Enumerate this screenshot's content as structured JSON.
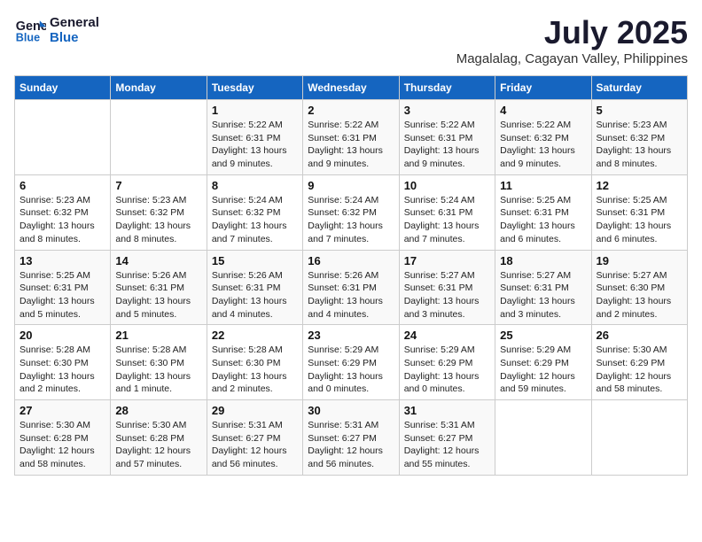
{
  "logo": {
    "line1": "General",
    "line2": "Blue"
  },
  "title": "July 2025",
  "location": "Magalalag, Cagayan Valley, Philippines",
  "weekdays": [
    "Sunday",
    "Monday",
    "Tuesday",
    "Wednesday",
    "Thursday",
    "Friday",
    "Saturday"
  ],
  "weeks": [
    [
      {
        "day": "",
        "info": ""
      },
      {
        "day": "",
        "info": ""
      },
      {
        "day": "1",
        "info": "Sunrise: 5:22 AM\nSunset: 6:31 PM\nDaylight: 13 hours and 9 minutes."
      },
      {
        "day": "2",
        "info": "Sunrise: 5:22 AM\nSunset: 6:31 PM\nDaylight: 13 hours and 9 minutes."
      },
      {
        "day": "3",
        "info": "Sunrise: 5:22 AM\nSunset: 6:31 PM\nDaylight: 13 hours and 9 minutes."
      },
      {
        "day": "4",
        "info": "Sunrise: 5:22 AM\nSunset: 6:32 PM\nDaylight: 13 hours and 9 minutes."
      },
      {
        "day": "5",
        "info": "Sunrise: 5:23 AM\nSunset: 6:32 PM\nDaylight: 13 hours and 8 minutes."
      }
    ],
    [
      {
        "day": "6",
        "info": "Sunrise: 5:23 AM\nSunset: 6:32 PM\nDaylight: 13 hours and 8 minutes."
      },
      {
        "day": "7",
        "info": "Sunrise: 5:23 AM\nSunset: 6:32 PM\nDaylight: 13 hours and 8 minutes."
      },
      {
        "day": "8",
        "info": "Sunrise: 5:24 AM\nSunset: 6:32 PM\nDaylight: 13 hours and 7 minutes."
      },
      {
        "day": "9",
        "info": "Sunrise: 5:24 AM\nSunset: 6:32 PM\nDaylight: 13 hours and 7 minutes."
      },
      {
        "day": "10",
        "info": "Sunrise: 5:24 AM\nSunset: 6:31 PM\nDaylight: 13 hours and 7 minutes."
      },
      {
        "day": "11",
        "info": "Sunrise: 5:25 AM\nSunset: 6:31 PM\nDaylight: 13 hours and 6 minutes."
      },
      {
        "day": "12",
        "info": "Sunrise: 5:25 AM\nSunset: 6:31 PM\nDaylight: 13 hours and 6 minutes."
      }
    ],
    [
      {
        "day": "13",
        "info": "Sunrise: 5:25 AM\nSunset: 6:31 PM\nDaylight: 13 hours and 5 minutes."
      },
      {
        "day": "14",
        "info": "Sunrise: 5:26 AM\nSunset: 6:31 PM\nDaylight: 13 hours and 5 minutes."
      },
      {
        "day": "15",
        "info": "Sunrise: 5:26 AM\nSunset: 6:31 PM\nDaylight: 13 hours and 4 minutes."
      },
      {
        "day": "16",
        "info": "Sunrise: 5:26 AM\nSunset: 6:31 PM\nDaylight: 13 hours and 4 minutes."
      },
      {
        "day": "17",
        "info": "Sunrise: 5:27 AM\nSunset: 6:31 PM\nDaylight: 13 hours and 3 minutes."
      },
      {
        "day": "18",
        "info": "Sunrise: 5:27 AM\nSunset: 6:31 PM\nDaylight: 13 hours and 3 minutes."
      },
      {
        "day": "19",
        "info": "Sunrise: 5:27 AM\nSunset: 6:30 PM\nDaylight: 13 hours and 2 minutes."
      }
    ],
    [
      {
        "day": "20",
        "info": "Sunrise: 5:28 AM\nSunset: 6:30 PM\nDaylight: 13 hours and 2 minutes."
      },
      {
        "day": "21",
        "info": "Sunrise: 5:28 AM\nSunset: 6:30 PM\nDaylight: 13 hours and 1 minute."
      },
      {
        "day": "22",
        "info": "Sunrise: 5:28 AM\nSunset: 6:30 PM\nDaylight: 13 hours and 2 minutes."
      },
      {
        "day": "23",
        "info": "Sunrise: 5:29 AM\nSunset: 6:29 PM\nDaylight: 13 hours and 0 minutes."
      },
      {
        "day": "24",
        "info": "Sunrise: 5:29 AM\nSunset: 6:29 PM\nDaylight: 13 hours and 0 minutes."
      },
      {
        "day": "25",
        "info": "Sunrise: 5:29 AM\nSunset: 6:29 PM\nDaylight: 12 hours and 59 minutes."
      },
      {
        "day": "26",
        "info": "Sunrise: 5:30 AM\nSunset: 6:29 PM\nDaylight: 12 hours and 58 minutes."
      }
    ],
    [
      {
        "day": "27",
        "info": "Sunrise: 5:30 AM\nSunset: 6:28 PM\nDaylight: 12 hours and 58 minutes."
      },
      {
        "day": "28",
        "info": "Sunrise: 5:30 AM\nSunset: 6:28 PM\nDaylight: 12 hours and 57 minutes."
      },
      {
        "day": "29",
        "info": "Sunrise: 5:31 AM\nSunset: 6:27 PM\nDaylight: 12 hours and 56 minutes."
      },
      {
        "day": "30",
        "info": "Sunrise: 5:31 AM\nSunset: 6:27 PM\nDaylight: 12 hours and 56 minutes."
      },
      {
        "day": "31",
        "info": "Sunrise: 5:31 AM\nSunset: 6:27 PM\nDaylight: 12 hours and 55 minutes."
      },
      {
        "day": "",
        "info": ""
      },
      {
        "day": "",
        "info": ""
      }
    ]
  ]
}
